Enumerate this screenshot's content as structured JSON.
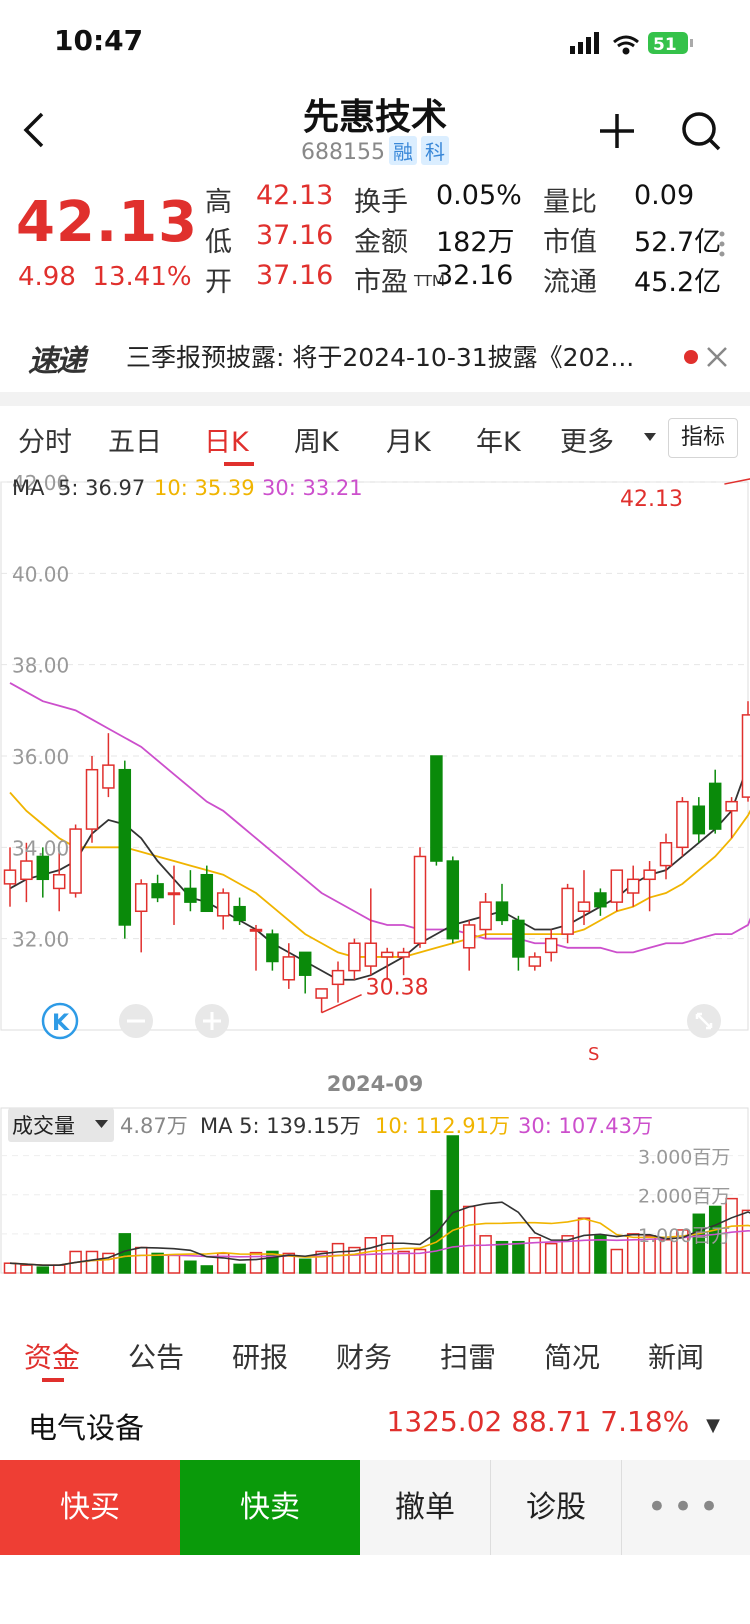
{
  "status": {
    "time": "10:47",
    "battery": "51"
  },
  "nav": {
    "title": "先惠技术",
    "code": "688155",
    "tag_margin": "融",
    "tag_star": "科"
  },
  "quote": {
    "price": "42.13",
    "change": "4.98",
    "change_pct": "13.41%",
    "stats": [
      {
        "label": "高",
        "value": "42.13",
        "color": "red"
      },
      {
        "label": "换手",
        "value": "0.05%",
        "color": "black"
      },
      {
        "label": "量比",
        "value": "0.09",
        "color": "black"
      },
      {
        "label": "低",
        "value": "37.16",
        "color": "red"
      },
      {
        "label": "金额",
        "value": "182万",
        "color": "black"
      },
      {
        "label": "市值",
        "value": "52.7亿",
        "color": "black"
      },
      {
        "label": "开",
        "value": "37.16",
        "color": "red"
      },
      {
        "label": "市盈",
        "sub": "TTM",
        "value": "32.16",
        "color": "black"
      },
      {
        "label": "流通",
        "value": "45.2亿",
        "color": "black"
      }
    ]
  },
  "banner": {
    "logo": "速递",
    "text": "三季报预披露: 将于2024-10-31披露《202..."
  },
  "chart_tabs": {
    "items": [
      "分时",
      "五日",
      "日K",
      "周K",
      "月K",
      "年K",
      "更多"
    ],
    "active": 2,
    "indicator_button": "指标"
  },
  "kline_legend": {
    "ma_label": "MA",
    "ma5": "5: 36.97",
    "ma10": "10: 35.39",
    "ma30": "30: 33.21"
  },
  "volume_legend": {
    "selector": "成交量",
    "current": "4.87万",
    "ma5": "MA 5: 139.15万",
    "ma10": "10: 112.91万",
    "ma30": "30: 107.43万"
  },
  "date_label": "2024-09",
  "colors": {
    "up": "#e0302d",
    "down": "#0a8a0a",
    "ma5": "#333333",
    "ma10": "#f0b400",
    "ma30": "#cc4fcc"
  },
  "chart_data": {
    "type": "candlestick",
    "y_ticks": [
      "42.00",
      "40.00",
      "38.00",
      "36.00",
      "34.00",
      "32.00"
    ],
    "ylim": [
      30.0,
      42.0
    ],
    "max_label": "42.13",
    "min_label": "30.38",
    "signal_label": "S",
    "volume_ticks": [
      "3.000百万",
      "2.000百万",
      "1.000百万"
    ],
    "volume_ylim": [
      0,
      3.5
    ],
    "candles": [
      {
        "o": 33.2,
        "h": 34.0,
        "l": 32.7,
        "c": 33.5
      },
      {
        "o": 33.3,
        "h": 34.1,
        "l": 32.8,
        "c": 33.7
      },
      {
        "o": 33.8,
        "h": 34.0,
        "l": 32.9,
        "c": 33.3
      },
      {
        "o": 33.1,
        "h": 33.9,
        "l": 32.6,
        "c": 33.4
      },
      {
        "o": 33.0,
        "h": 34.5,
        "l": 32.9,
        "c": 34.4
      },
      {
        "o": 34.4,
        "h": 36.0,
        "l": 34.1,
        "c": 35.7
      },
      {
        "o": 35.3,
        "h": 36.5,
        "l": 35.1,
        "c": 35.8
      },
      {
        "o": 35.7,
        "h": 35.9,
        "l": 32.0,
        "c": 32.3
      },
      {
        "o": 32.6,
        "h": 33.3,
        "l": 31.7,
        "c": 33.2
      },
      {
        "o": 33.2,
        "h": 33.4,
        "l": 32.8,
        "c": 32.9
      },
      {
        "o": 33.0,
        "h": 33.6,
        "l": 32.3,
        "c": 33.0
      },
      {
        "o": 33.1,
        "h": 33.5,
        "l": 32.6,
        "c": 32.8
      },
      {
        "o": 33.4,
        "h": 33.6,
        "l": 32.6,
        "c": 32.6
      },
      {
        "o": 32.5,
        "h": 33.1,
        "l": 32.2,
        "c": 33.0
      },
      {
        "o": 32.7,
        "h": 32.9,
        "l": 32.3,
        "c": 32.4
      },
      {
        "o": 32.2,
        "h": 32.3,
        "l": 31.3,
        "c": 32.2
      },
      {
        "o": 32.1,
        "h": 32.2,
        "l": 31.3,
        "c": 31.5
      },
      {
        "o": 31.1,
        "h": 31.9,
        "l": 30.9,
        "c": 31.6
      },
      {
        "o": 31.7,
        "h": 31.7,
        "l": 30.8,
        "c": 31.2
      },
      {
        "o": 30.7,
        "h": 30.9,
        "l": 30.38,
        "c": 30.9
      },
      {
        "o": 31.0,
        "h": 31.5,
        "l": 30.6,
        "c": 31.3
      },
      {
        "o": 31.3,
        "h": 32.0,
        "l": 31.1,
        "c": 31.9
      },
      {
        "o": 31.4,
        "h": 33.1,
        "l": 31.2,
        "c": 31.9
      },
      {
        "o": 31.6,
        "h": 31.8,
        "l": 31.1,
        "c": 31.7
      },
      {
        "o": 31.6,
        "h": 31.8,
        "l": 31.2,
        "c": 31.7
      },
      {
        "o": 31.9,
        "h": 34.0,
        "l": 31.8,
        "c": 33.8
      },
      {
        "o": 36.0,
        "h": 36.0,
        "l": 33.6,
        "c": 33.7
      },
      {
        "o": 33.7,
        "h": 33.8,
        "l": 31.9,
        "c": 32.0
      },
      {
        "o": 31.8,
        "h": 32.4,
        "l": 31.3,
        "c": 32.3
      },
      {
        "o": 32.2,
        "h": 33.0,
        "l": 32.0,
        "c": 32.8
      },
      {
        "o": 32.8,
        "h": 33.2,
        "l": 32.3,
        "c": 32.4
      },
      {
        "o": 32.4,
        "h": 32.5,
        "l": 31.3,
        "c": 31.6
      },
      {
        "o": 31.4,
        "h": 31.7,
        "l": 31.3,
        "c": 31.6
      },
      {
        "o": 31.7,
        "h": 32.2,
        "l": 31.5,
        "c": 32.0
      },
      {
        "o": 32.1,
        "h": 33.2,
        "l": 31.9,
        "c": 33.1
      },
      {
        "o": 32.6,
        "h": 33.5,
        "l": 32.3,
        "c": 32.8
      },
      {
        "o": 33.0,
        "h": 33.1,
        "l": 32.5,
        "c": 32.7
      },
      {
        "o": 32.8,
        "h": 33.5,
        "l": 32.6,
        "c": 33.5
      },
      {
        "o": 33.0,
        "h": 33.6,
        "l": 32.7,
        "c": 33.3
      },
      {
        "o": 33.3,
        "h": 33.7,
        "l": 32.6,
        "c": 33.5
      },
      {
        "o": 33.6,
        "h": 34.3,
        "l": 33.3,
        "c": 34.1
      },
      {
        "o": 34.0,
        "h": 35.1,
        "l": 33.8,
        "c": 35.0
      },
      {
        "o": 34.9,
        "h": 35.1,
        "l": 34.1,
        "c": 34.3
      },
      {
        "o": 35.4,
        "h": 35.7,
        "l": 34.3,
        "c": 34.4
      },
      {
        "o": 34.8,
        "h": 35.1,
        "l": 34.2,
        "c": 35.0
      },
      {
        "o": 35.1,
        "h": 37.2,
        "l": 35.0,
        "c": 36.9
      },
      {
        "o": 37.16,
        "h": 42.13,
        "l": 37.16,
        "c": 42.13
      }
    ],
    "volumes": [
      0.25,
      0.2,
      0.15,
      0.2,
      0.55,
      0.55,
      0.5,
      1.0,
      0.65,
      0.5,
      0.45,
      0.3,
      0.18,
      0.5,
      0.22,
      0.52,
      0.55,
      0.5,
      0.35,
      0.55,
      0.75,
      0.65,
      0.9,
      0.95,
      0.55,
      0.6,
      2.1,
      3.5,
      1.7,
      0.95,
      0.8,
      0.8,
      0.9,
      0.75,
      0.95,
      1.4,
      0.95,
      0.6,
      1.0,
      0.95,
      0.85,
      1.1,
      1.5,
      1.7,
      1.9,
      1.6,
      0.09
    ],
    "ma5": [
      33.1,
      33.3,
      33.4,
      33.5,
      33.7,
      34.3,
      34.6,
      34.5,
      34.2,
      33.7,
      33.3,
      32.9,
      32.8,
      32.6,
      32.4,
      32.2,
      31.9,
      31.7,
      31.5,
      31.3,
      31.1,
      31.1,
      31.2,
      31.4,
      31.6,
      31.9,
      32.1,
      32.3,
      32.4,
      32.5,
      32.6,
      32.4,
      32.2,
      32.2,
      32.3,
      32.5,
      32.7,
      32.9,
      33.2,
      33.4,
      33.5,
      33.8,
      34.1,
      34.4,
      34.8,
      35.8,
      36.97
    ],
    "ma10": [
      35.2,
      34.8,
      34.5,
      34.2,
      34.0,
      34.0,
      34.0,
      34.0,
      33.9,
      33.8,
      33.7,
      33.6,
      33.5,
      33.4,
      33.2,
      33.0,
      32.7,
      32.4,
      32.1,
      31.9,
      31.7,
      31.6,
      31.6,
      31.6,
      31.6,
      31.7,
      31.8,
      31.9,
      32.0,
      32.1,
      32.1,
      32.1,
      32.1,
      32.1,
      32.1,
      32.2,
      32.4,
      32.6,
      32.7,
      32.9,
      33.0,
      33.2,
      33.5,
      33.8,
      34.2,
      34.7,
      35.39
    ],
    "ma30": [
      37.6,
      37.4,
      37.2,
      37.1,
      37.0,
      36.8,
      36.6,
      36.4,
      36.2,
      35.9,
      35.6,
      35.3,
      35.0,
      34.8,
      34.5,
      34.2,
      33.9,
      33.6,
      33.3,
      33.0,
      32.8,
      32.6,
      32.4,
      32.3,
      32.3,
      32.2,
      32.2,
      32.2,
      32.1,
      32.0,
      32.0,
      32.0,
      31.9,
      31.9,
      31.8,
      31.8,
      31.8,
      31.7,
      31.7,
      31.8,
      31.9,
      31.9,
      32.0,
      32.1,
      32.1,
      32.3,
      33.21
    ]
  },
  "bottom_tabs": {
    "items": [
      "资金",
      "公告",
      "研报",
      "财务",
      "扫雷",
      "简况",
      "新闻"
    ],
    "active": 0
  },
  "sector": {
    "name": "电气设备",
    "values": "1325.02  88.71  7.18%"
  },
  "actions": {
    "buy": "快买",
    "sell": "快卖",
    "cancel": "撤单",
    "diagnose": "诊股"
  }
}
